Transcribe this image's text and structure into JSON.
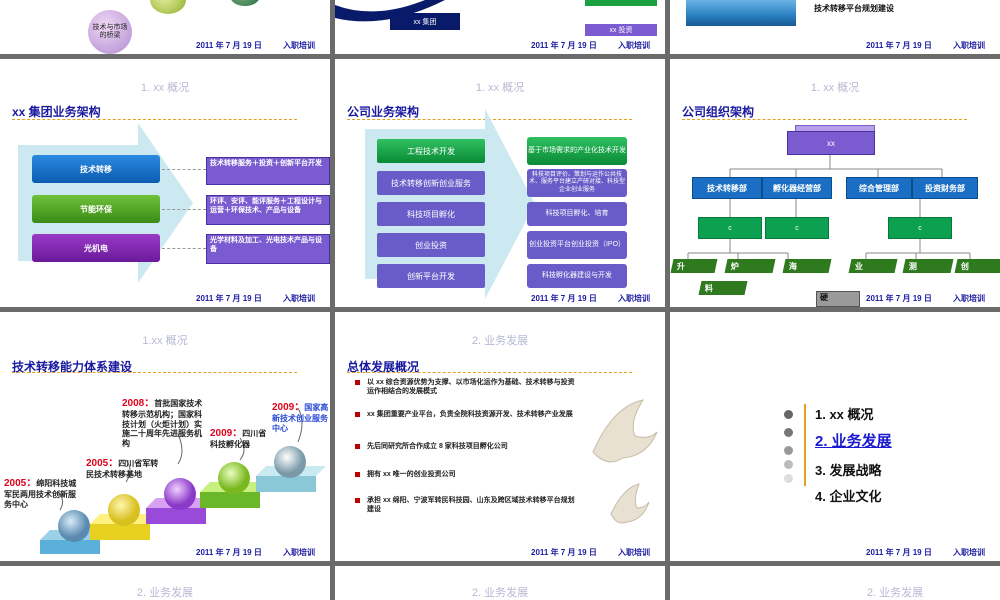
{
  "footer": {
    "date": "2011 年 7 月 19 日",
    "training": "入职培训"
  },
  "slides": {
    "top_left": {
      "circle_label": "技术与市场的桥梁"
    },
    "top_mid": {
      "left_label": "xx 集团",
      "right_label": "xx 投资"
    },
    "top_right": {
      "text": "技术转移平台规划建设"
    },
    "business": {
      "section": "1. xx 概况",
      "title": "xx 集团业务架构",
      "bars": [
        "技术转移",
        "节能环保",
        "光机电"
      ],
      "details": [
        "技术转移服务＋投资＋创新平台开发",
        "环评、安评、能评服务＋工程设计与运营＋环保技术、产品与设备",
        "光学材料及加工、光电技术产品与设备"
      ]
    },
    "company": {
      "section": "1. xx 概况",
      "title": "公司业务架构",
      "left": [
        "工程技术开发",
        "技术转移创新创业服务",
        "科技项目孵化",
        "创业投资",
        "创新平台开发"
      ],
      "right": [
        "基于市场需求的产业化技术开发",
        "科技项目评价、策划与运作公共技术、服务平台建立产研对接、科技型企业创业服务",
        "科技项目孵化、培育",
        "创业投资平台创业投资（IPO）",
        "科技孵化器建设与开发"
      ]
    },
    "org": {
      "section": "1. xx 概况",
      "title": "公司组织架构",
      "top": "xx",
      "departments": [
        "技术转移部",
        "孵化器经营部",
        "综合管理部",
        "投资财务部"
      ],
      "sub": [
        "c",
        "c",
        "c"
      ],
      "leaves": [
        "升",
        "炉",
        "海",
        "业",
        "测",
        "创",
        "料",
        "硬"
      ]
    },
    "capability": {
      "section": "1.xx 概况",
      "title": "技术转移能力体系建设",
      "milestones": [
        {
          "year": "2005：",
          "text": "绵阳科技城军民两用技术创新服务中心"
        },
        {
          "year": "2005：",
          "text": "四川省军转民技术转移基地"
        },
        {
          "year": "2008：",
          "text": "首批国家技术转移示范机构；国家科技计划（火炬计划）实施二十周年先进服务机构"
        },
        {
          "year": "2009：",
          "text": "四川省科技孵化器"
        },
        {
          "year": "2009：",
          "text": "国家高新技术创业服务中心"
        }
      ]
    },
    "overview": {
      "section": "2. 业务发展",
      "title": "总体发展概况",
      "bullets": [
        "以 xx 综合资源优势为支撑、以市场化运作为基础、技术转移与投资运作相结合的发展模式",
        "xx 集团重要产业平台，负责全院科技资源开发、技术转移产业发展",
        "先后同研究所合作成立 8 家科技项目孵化公司",
        "拥有 xx 唯一的创业投资公司",
        "承担 xx 绵阳、宁波军转民科技园、山东及跨区域技术转移平台规划建设"
      ]
    },
    "toc": {
      "items": [
        "1. xx 概况",
        "2. 业务发展",
        "3. 发展战略",
        "4. 企业文化"
      ],
      "active": 1
    },
    "bottom": {
      "sections": [
        "2. 业务发展",
        "2. 业务发展",
        "2. 业务发展"
      ]
    }
  }
}
